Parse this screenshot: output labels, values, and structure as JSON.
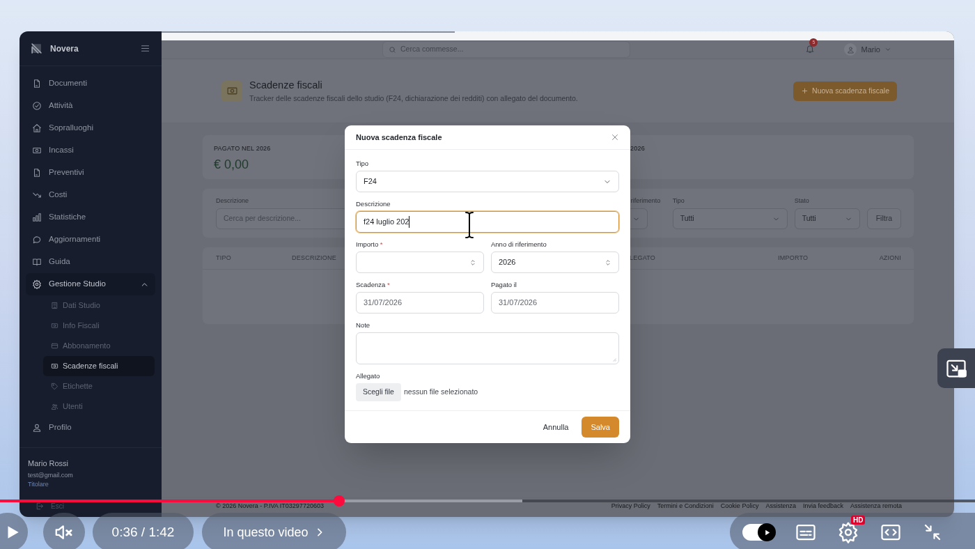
{
  "player": {
    "playing": false,
    "muted": true,
    "time": "0:36 / 1:42",
    "chapter": "In questo video",
    "progress": {
      "level": 0.348
    },
    "buffered": {
      "level": 0.536
    },
    "autoplay": true,
    "quality_badge": "HD"
  },
  "app": {
    "sidebar": {
      "brand": "Novera",
      "items": [
        {
          "label": "Documenti",
          "selected": false
        },
        {
          "label": "Attività",
          "selected": false
        },
        {
          "label": "Sopralluoghi",
          "selected": false
        },
        {
          "label": "Incassi",
          "selected": false
        },
        {
          "label": "Preventivi",
          "selected": false
        },
        {
          "label": "Costi",
          "selected": false
        },
        {
          "label": "Statistiche",
          "selected": false
        },
        {
          "label": "Aggiornamenti",
          "selected": false
        },
        {
          "label": "Guida",
          "selected": false
        },
        {
          "label": "Gestione Studio",
          "selected": false,
          "expanded": true,
          "children": [
            {
              "label": "Dati Studio",
              "selected": false
            },
            {
              "label": "Info Fiscali",
              "selected": false
            },
            {
              "label": "Abbonamento",
              "selected": false
            },
            {
              "label": "Scadenze fiscali",
              "selected": true
            },
            {
              "label": "Etichette",
              "selected": false
            },
            {
              "label": "Utenti",
              "selected": false
            }
          ]
        },
        {
          "label": "Profilo",
          "selected": false
        }
      ],
      "user": {
        "name": "Mario Rossi",
        "email": "test@gmail.com",
        "role": "Titolare"
      },
      "logout": "Esci"
    },
    "topbar": {
      "search_placeholder": "Cerca commesse...",
      "notifications": "5",
      "user": "Mario"
    },
    "header": {
      "title": "Scadenze fiscali",
      "subtitle": "Tracker delle scadenze fiscali dello studio (F24, dichiarazione dei redditi) con allegato del documento.",
      "button": "Nuova scadenza fiscale"
    },
    "stats": [
      {
        "label": "PAGATO NEL 2026",
        "value": "€ 0,00"
      },
      {
        "label": "2026"
      }
    ],
    "filters": {
      "description_label": "Descrizione",
      "description_placeholder": "Cerca per descrizione...",
      "year_label": "riferimento",
      "type_label": "Tipo",
      "type_value": "Tutti",
      "state_label": "Stato",
      "state_value": "Tutti",
      "button": "Filtra"
    },
    "table": {
      "columns": [
        "TIPO",
        "DESCRIZIONE",
        "LEGATO",
        "IMPORTO",
        "AZIONI"
      ]
    },
    "footer": {
      "copyright": "© 2026 Novera - P.IVA IT03297720603",
      "links": [
        "Privacy Policy",
        "Termini e Condizioni",
        "Cookie Policy",
        "Assistenza",
        "Invia feedback",
        "Assistenza remota"
      ]
    }
  },
  "modal": {
    "title": "Nuova scadenza fiscale",
    "fields": [
      {
        "kind": "select",
        "label": "Tipo",
        "value": "F24"
      },
      {
        "kind": "text",
        "label": "Descrizione",
        "value": "f24 luglio 202",
        "focused": true
      },
      {
        "kind": "number",
        "label": "Importo",
        "required_mark": "*"
      },
      {
        "kind": "number",
        "label": "Anno di riferimento",
        "value": "2026"
      },
      {
        "kind": "date",
        "label": "Scadenza",
        "required_mark": "*",
        "value": "31/07/2026"
      },
      {
        "kind": "date",
        "label": "Pagato il",
        "value": "31/07/2026"
      },
      {
        "kind": "textarea",
        "label": "Note"
      },
      {
        "kind": "file",
        "label": "Allegato",
        "button": "Scegli file",
        "status": "nessun file selezionato"
      }
    ],
    "buttons": [
      {
        "kind": "secondary",
        "label": "Annulla"
      },
      {
        "kind": "primary",
        "label": "Salva"
      }
    ]
  }
}
